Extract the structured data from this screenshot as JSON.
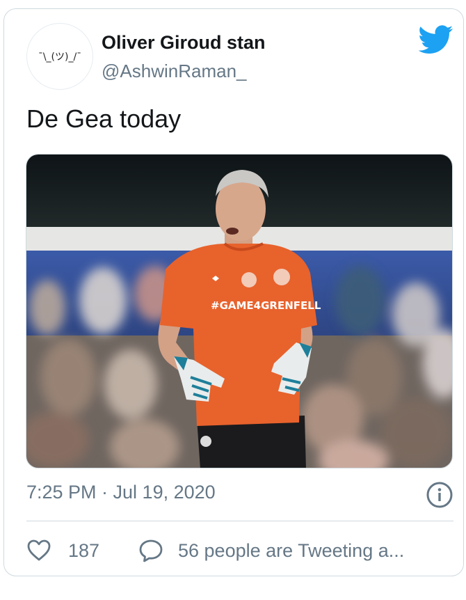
{
  "author": {
    "avatar_text": "¯\\_(ツ)_/¯",
    "display_name": "Oliver Giroud stan",
    "handle": "@AshwinRaman_"
  },
  "tweet": {
    "text": "De Gea today",
    "timestamp": "7:25 PM · Jul 19, 2020",
    "shirt_text": "#GAME4GRENFELL"
  },
  "actions": {
    "like_count": "187",
    "reply_label": "56 people are Tweeting a..."
  },
  "icons": {
    "brand": "twitter-bird-icon",
    "info": "info-icon",
    "like": "heart-icon",
    "reply": "speech-bubble-icon"
  },
  "colors": {
    "brand_blue": "#1da1f2",
    "secondary_text": "#657786",
    "border": "#cfd9de",
    "shirt_orange": "#e8622c"
  }
}
